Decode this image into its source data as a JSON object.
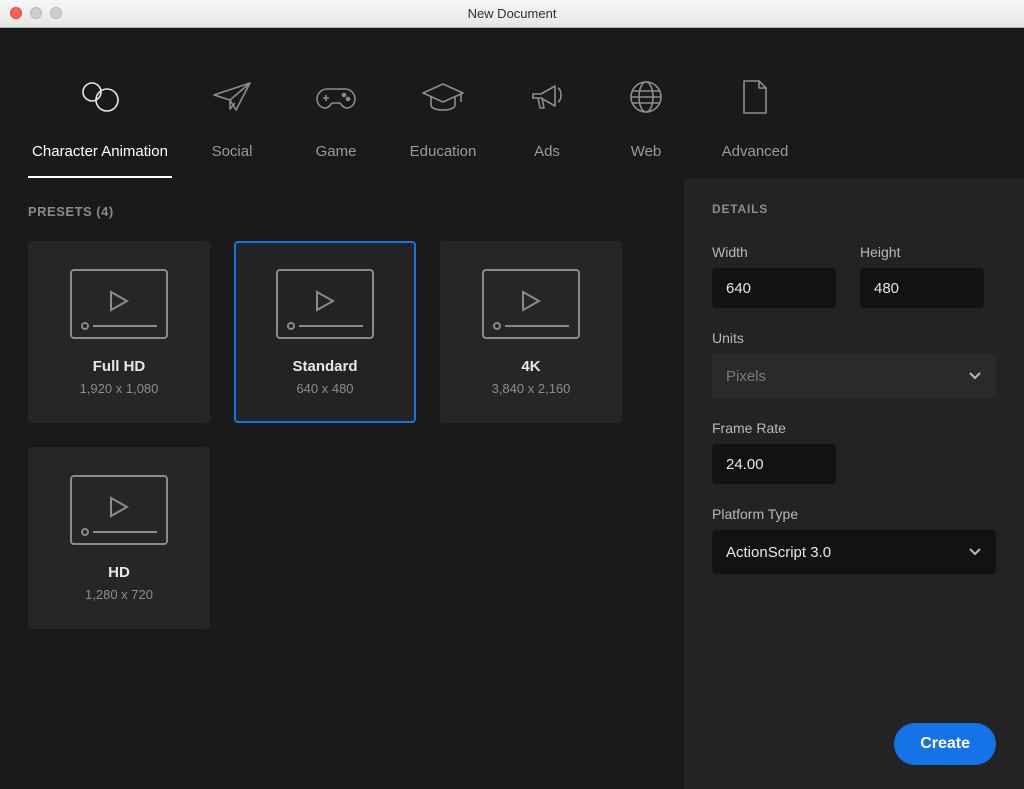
{
  "window": {
    "title": "New Document"
  },
  "categories": [
    {
      "label": "Character Animation",
      "active": true
    },
    {
      "label": "Social"
    },
    {
      "label": "Game"
    },
    {
      "label": "Education"
    },
    {
      "label": "Ads"
    },
    {
      "label": "Web"
    },
    {
      "label": "Advanced"
    }
  ],
  "presets": {
    "heading": "PRESETS (4)",
    "items": [
      {
        "name": "Full HD",
        "dims": "1,920 x 1,080",
        "selected": false
      },
      {
        "name": "Standard",
        "dims": "640 x 480",
        "selected": true
      },
      {
        "name": "4K",
        "dims": "3,840 x 2,160",
        "selected": false
      },
      {
        "name": "HD",
        "dims": "1,280 x 720",
        "selected": false
      }
    ]
  },
  "details": {
    "heading": "DETAILS",
    "width_label": "Width",
    "width_value": "640",
    "height_label": "Height",
    "height_value": "480",
    "units_label": "Units",
    "units_value": "Pixels",
    "framerate_label": "Frame Rate",
    "framerate_value": "24.00",
    "platform_label": "Platform Type",
    "platform_value": "ActionScript 3.0"
  },
  "actions": {
    "create_label": "Create"
  }
}
